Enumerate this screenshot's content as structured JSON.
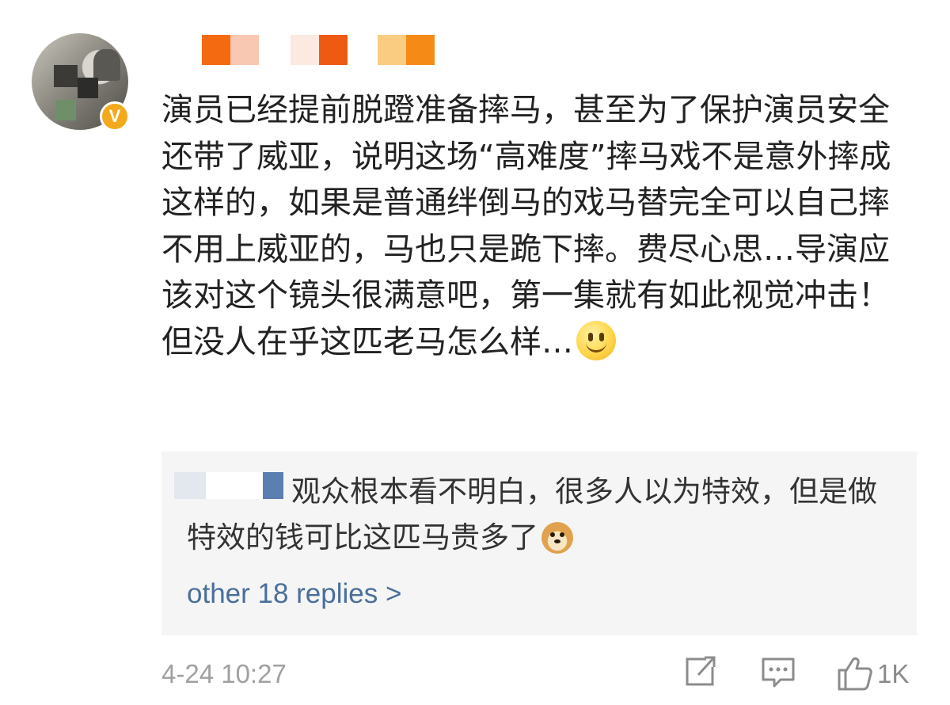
{
  "post": {
    "body": "演员已经提前脱蹬准备摔马，甚至为了保护演员安全还带了威亚，说明这场“高难度”摔马戏不是意外摔成这样的，如果是普通绊倒马的戏马替完全可以自己摔不用上威亚的，马也只是跪下摔。费尽心思…导演应该对这个镜头很满意吧，第一集就有如此视觉冲击！但没人在乎这匹老马怎么样…",
    "badge_text": "V",
    "badge_color": "#f2a91b",
    "username_mask_colors": [
      "#f46a10",
      "#f8c8b2",
      "#ffffff",
      "#fbe9e2",
      "#ef5a12",
      "#ffffff",
      "#f9cc82",
      "#f58a16"
    ],
    "reply_name_mask_colors": [
      "#e3e7ee",
      "#ffffff",
      "#5b7fb1"
    ],
    "emoji_icon": "smiley-emoji-icon",
    "timestamp": "4-24 10:27"
  },
  "reply": {
    "text": "观众根本看不明白，很多人以为特效，但是做特效的钱可比这匹马贵多了",
    "emoji_icon": "doge-emoji-icon",
    "more_link": "other 18 replies >",
    "link_color": "#4a6f9a"
  },
  "actions": {
    "share_icon": "share-icon",
    "comment_icon": "comment-icon",
    "like_icon": "thumbs-up-icon",
    "like_count": "1K"
  }
}
